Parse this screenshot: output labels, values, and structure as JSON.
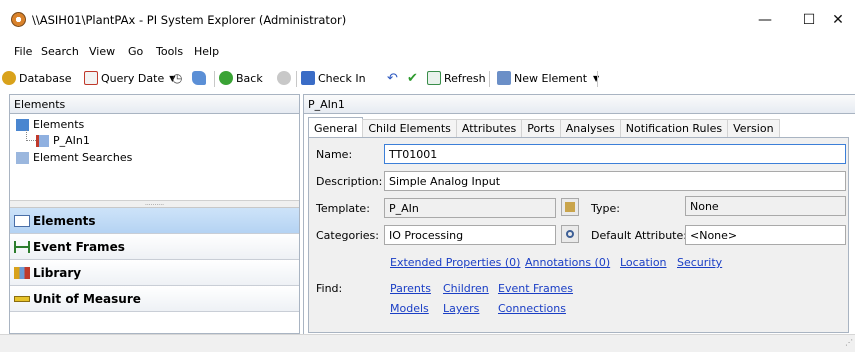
{
  "window": {
    "title": "\\\\ASIH01\\PlantPAx - PI System Explorer (Administrator)",
    "minimize": "—",
    "maximize": "☐",
    "close": "✕"
  },
  "menu": [
    "File",
    "Search",
    "View",
    "Go",
    "Tools",
    "Help"
  ],
  "toolbar": {
    "database": "Database",
    "query_date": "Query Date",
    "back": "Back",
    "check_in": "Check In",
    "refresh": "Refresh",
    "new_element": "New Element"
  },
  "left": {
    "header": "Elements",
    "tree": [
      {
        "label": "Elements",
        "icon": "elements-root-icon"
      },
      {
        "label": "P_AIn1",
        "icon": "element-icon"
      },
      {
        "label": "Element Searches",
        "icon": "element-search-icon"
      }
    ],
    "splitter": "..........",
    "nav": [
      {
        "label": "Elements",
        "icon": "elements-icon"
      },
      {
        "label": "Event Frames",
        "icon": "event-frames-icon"
      },
      {
        "label": "Library",
        "icon": "library-icon"
      },
      {
        "label": "Unit of Measure",
        "icon": "ruler-icon"
      }
    ]
  },
  "right": {
    "header": "P_AIn1",
    "tabs": [
      "General",
      "Child Elements",
      "Attributes",
      "Ports",
      "Analyses",
      "Notification Rules",
      "Version"
    ],
    "form": {
      "name_label": "Name:",
      "name_value": "TT01001",
      "description_label": "Description:",
      "description_value": "Simple Analog Input",
      "template_label": "Template:",
      "template_value": "P_AIn",
      "type_label": "Type:",
      "type_value": "None",
      "categories_label": "Categories:",
      "categories_value": "IO Processing",
      "default_attribute_label": "Default Attribute:",
      "default_attribute_value": "<None>",
      "find_label": "Find:"
    },
    "links": {
      "extended_properties": "Extended Properties (0)",
      "annotations": "Annotations (0)",
      "location": "Location",
      "security": "Security",
      "parents": "Parents",
      "children": "Children",
      "event_frames": "Event Frames",
      "models": "Models",
      "layers": "Layers",
      "connections": "Connections"
    }
  }
}
